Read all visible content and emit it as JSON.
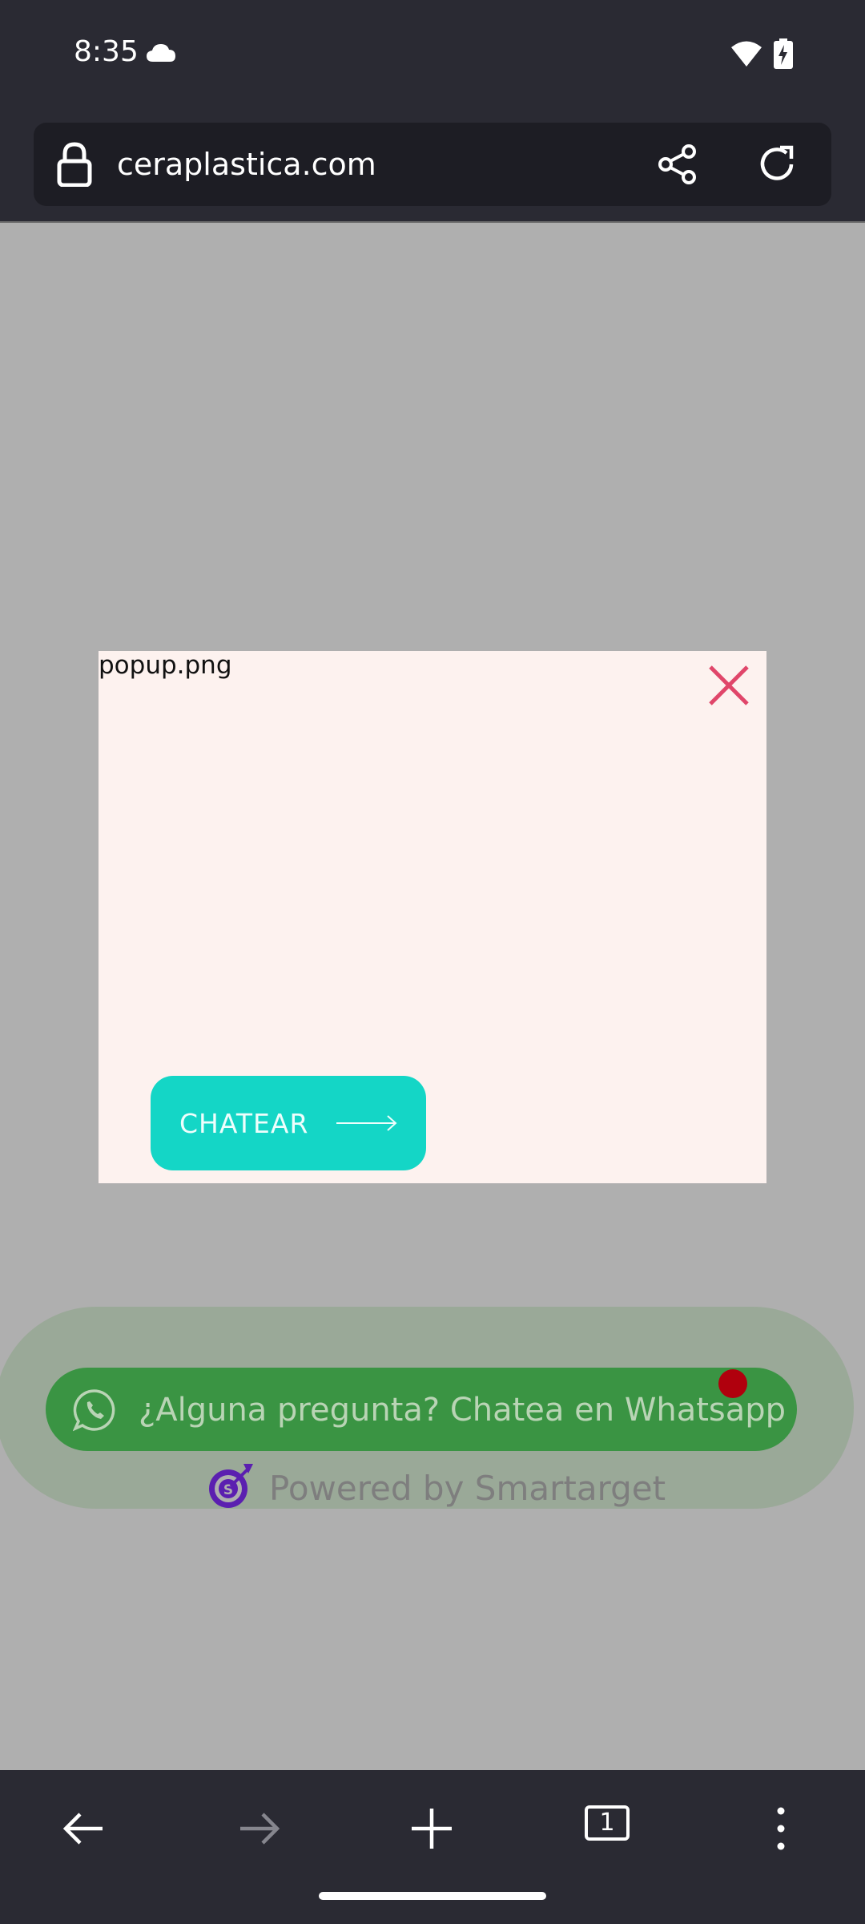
{
  "status_bar": {
    "time": "8:35"
  },
  "browser": {
    "url": "ceraplastica.com",
    "open_tabs": "1"
  },
  "popup": {
    "image_alt": "popup.png",
    "cta_label": "CHATEAR",
    "colors": {
      "background": "#fdf2ef",
      "cta": "#14d6c6",
      "close": "#e0466a"
    }
  },
  "whatsapp_widget": {
    "label": "¿Alguna pregunta? Chatea en Whatsapp",
    "powered_by": "Powered by Smartarget",
    "colors": {
      "pill": "#3a9443",
      "notification": "#b0000d",
      "brand": "#5b1fb0"
    }
  },
  "icons": [
    "cloud-icon",
    "wifi-icon",
    "battery-icon",
    "lock-icon",
    "share-icon",
    "reload-icon",
    "close-icon",
    "arrow-right-icon",
    "whatsapp-icon",
    "target-icon",
    "back-icon",
    "forward-icon",
    "new-tab-icon",
    "tabs-icon",
    "more-icon"
  ]
}
